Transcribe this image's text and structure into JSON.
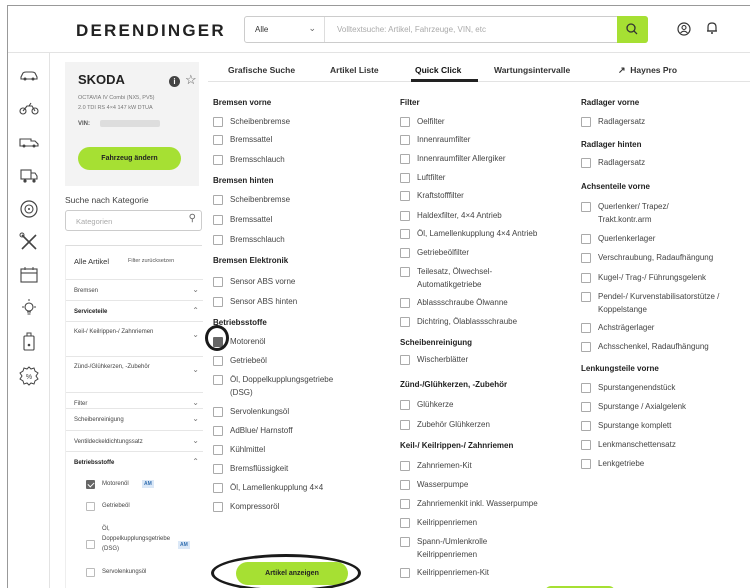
{
  "header": {
    "logo": "DERENDINGER",
    "search_scope": "Alle",
    "search_placeholder": "Volltextsuche: Artikel, Fahrzeuge, VIN, etc",
    "icons": [
      "search-icon",
      "user-icon",
      "bell-icon"
    ]
  },
  "sidebar_icons": [
    "car-icon",
    "motorcycle-icon",
    "van-icon",
    "truck-icon",
    "tire-icon",
    "tools-icon",
    "calendar-icon",
    "lightbulb-icon",
    "oil-can-icon",
    "percent-icon"
  ],
  "vehicle": {
    "make": "SKODA",
    "model": "OCTAVIA IV Combi (NX5, PV5)",
    "engine": "2.0 TDI RS 4×4 147 kW DTUA",
    "vin_label": "VIN:",
    "change_button": "Fahrzeug ändern"
  },
  "category_search": {
    "label": "Suche nach Kategorie",
    "placeholder": "Kategorien"
  },
  "filter_panel": {
    "title": "Alle Artikel",
    "reset": "Filter zurücksetzen",
    "rows": [
      {
        "label": "Bremsen",
        "bold": false
      },
      {
        "label": "Serviceteile",
        "bold": true
      },
      {
        "label": "Keil-/ Keilrippen-/ Zahnriemen",
        "bold": false
      },
      {
        "label": "Zünd-/Glühkerzen, -Zubehör",
        "bold": false
      },
      {
        "label": "Filter",
        "bold": false
      },
      {
        "label": "Scheibenreinigung",
        "bold": false
      },
      {
        "label": "Ventildeckeldichtungssatz",
        "bold": false
      },
      {
        "label": "Betriebsstoffe",
        "bold": true
      }
    ],
    "checks": [
      {
        "label": "Motorenöl",
        "badge": "AM",
        "checked": true
      },
      {
        "label": "Getriebeöl",
        "badge": "",
        "checked": false
      },
      {
        "label": "Öl, Doppelkupplungsgetriebe (DSG)",
        "badge": "AM",
        "checked": false
      },
      {
        "label": "Servolenkungsöl",
        "badge": "",
        "checked": false
      }
    ]
  },
  "tabs": [
    "Grafische Suche",
    "Artikel Liste",
    "Quick Click",
    "Wartungsintervalle",
    "Haynes Pro"
  ],
  "active_tab": "Quick Click",
  "columns": {
    "bremsen_vorne": {
      "title": "Bremsen vorne",
      "items": [
        "Scheibenbremse",
        "Bremssattel",
        "Bremsschlauch"
      ]
    },
    "bremsen_hinten": {
      "title": "Bremsen hinten",
      "items": [
        "Scheibenbremse",
        "Bremssattel",
        "Bremsschlauch"
      ]
    },
    "bremsen_elektronik": {
      "title": "Bremsen Elektronik",
      "items": [
        "Sensor ABS vorne",
        "Sensor ABS hinten"
      ]
    },
    "betriebsstoffe": {
      "title": "Betriebsstoffe",
      "items": [
        "Motorenöl",
        "Getriebeöl",
        "Öl, Doppelkupplungsgetriebe",
        "(DSG)",
        "Servolenkungsöl",
        "AdBlue/ Harnstoff",
        "Kühlmittel",
        "Bremsflüssigkeit",
        "Öl, Lamellenkupplung 4×4",
        "Kompressoröl"
      ]
    },
    "filter": {
      "title": "Filter",
      "items": [
        "Oelfilter",
        "Innenraumfilter",
        "Innenraumfilter Allergiker",
        "Luftfilter",
        "Kraftstofffilter",
        "Haldexfilter, 4×4 Antrieb",
        "Öl, Lamellenkupplung 4×4 Antrieb",
        "Getriebeölfilter",
        "Teilesatz, Ölwechsel-",
        "Automatikgetriebe",
        "Ablassschraube Ölwanne",
        "Dichtring, Ölablassschraube"
      ]
    },
    "scheibenreinigung": {
      "title": "Scheibenreinigung",
      "items": [
        "Wischerblätter"
      ]
    },
    "zuend": {
      "title": "Zünd-/Glühkerzen, -Zubehör",
      "items": [
        "Glühkerze",
        "Zubehör Glühkerzen"
      ]
    },
    "keil": {
      "title": "Keil-/ Keilrippen-/ Zahnriemen",
      "items": [
        "Zahnriemen-Kit",
        "Wasserpumpe",
        "Zahnriemenkit inkl. Wasserpumpe",
        "Keilrippenriemen",
        "Spann-/Umlenkrolle",
        "Keilrippenriemen",
        "Keilrippenriemen-Kit"
      ]
    },
    "radlager_vorne": {
      "title": "Radlager vorne",
      "items": [
        "Radlagersatz"
      ]
    },
    "radlager_hinten": {
      "title": "Radlager hinten",
      "items": [
        "Radlagersatz"
      ]
    },
    "achsenteile": {
      "title": "Achsenteile vorne",
      "items": [
        "Querlenker/ Trapez/",
        "Trakt.kontr.arm",
        "Querlenkerlager",
        "Verschraubung, Radaufhängung",
        "Kugel-/ Trag-/ Führungsgelenk",
        "Pendel-/ Kurvenstabilisatorstütze /",
        "Koppelstange",
        "Achsträgerlager",
        "Achsschenkel, Radaufhängung"
      ]
    },
    "lenkung": {
      "title": "Lenkungsteile vorne",
      "items": [
        "Spurstangenendstück",
        "Spurstange / Axialgelenk",
        "Spurstange komplett",
        "Lenkmanschettensatz",
        "Lenkgetriebe"
      ]
    }
  },
  "show_button": "Artikel anzeigen"
}
